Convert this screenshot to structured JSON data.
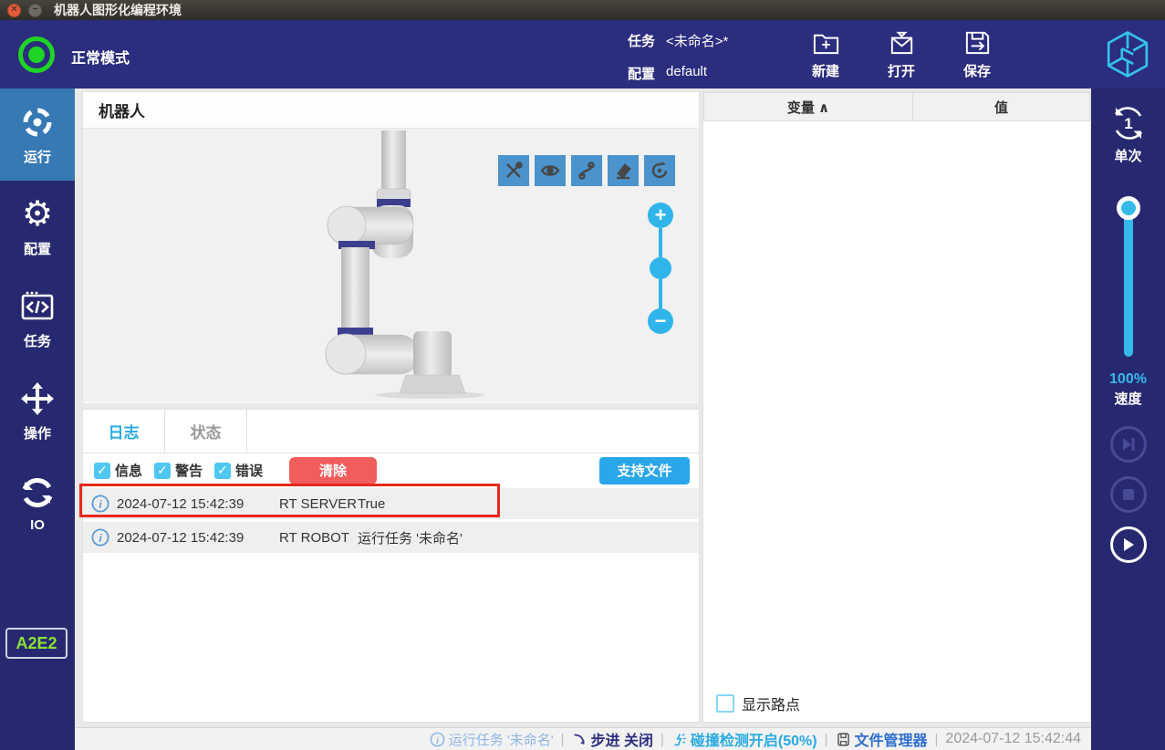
{
  "window": {
    "title": "机器人图形化编程环境"
  },
  "header": {
    "mode": "正常模式",
    "task_label": "任务",
    "task_value": "<未命名>*",
    "config_label": "配置",
    "config_value": "default",
    "actions": [
      {
        "icon": "new-folder-icon",
        "label": "新建"
      },
      {
        "icon": "open-icon",
        "label": "打开"
      },
      {
        "icon": "save-icon",
        "label": "保存"
      }
    ],
    "logo_icon": "cube-logo"
  },
  "sidebar": {
    "items": [
      {
        "icon": "run-target-icon",
        "label": "运行",
        "active": true
      },
      {
        "icon": "gear-icon",
        "label": "配置",
        "active": false
      },
      {
        "icon": "code-window-icon",
        "label": "任务",
        "active": false
      },
      {
        "icon": "move-arrows-icon",
        "label": "操作",
        "active": false
      },
      {
        "icon": "io-swap-icon",
        "label": "IO",
        "active": false
      }
    ],
    "badge": "A2E2"
  },
  "robot_panel": {
    "title": "机器人",
    "toolbar_icons": [
      "tools-icon",
      "eye-icon",
      "path-icon",
      "eraser-icon",
      "rotate-icon"
    ],
    "zoom_in": "+",
    "zoom_out": "−"
  },
  "log_panel": {
    "tabs": [
      {
        "label": "日志",
        "active": true
      },
      {
        "label": "状态",
        "active": false
      }
    ],
    "filters": [
      {
        "label": "信息",
        "checked": true
      },
      {
        "label": "警告",
        "checked": true
      },
      {
        "label": "错误",
        "checked": true
      }
    ],
    "check_glyph": "✓",
    "clear_button": "清除",
    "support_button": "支持文件",
    "entries": [
      {
        "icon": "info-icon",
        "time": "2024-07-12 15:42:39",
        "source": "RT SERVER",
        "message": "True",
        "highlighted": true
      },
      {
        "icon": "info-icon",
        "time": "2024-07-12 15:42:39",
        "source": "RT ROBOT",
        "message": "运行任务 '未命名'",
        "highlighted": false
      }
    ]
  },
  "variables_panel": {
    "col_variable": "变量 ∧",
    "col_value": "值",
    "show_waypoints_label": "显示路点",
    "show_waypoints_checked": false
  },
  "run_sidebar": {
    "loop_count": "1",
    "loop_label": "单次",
    "speed_value": "100%",
    "speed_label": "速度",
    "buttons": [
      {
        "icon": "step-forward-icon",
        "enabled": false
      },
      {
        "icon": "stop-icon",
        "enabled": false
      },
      {
        "icon": "play-icon",
        "enabled": true
      }
    ]
  },
  "status_bar": {
    "task_status": "运行任务 '未命名'",
    "step_status": "步进 关闭",
    "collision_status": "碰撞检测开启(50%)",
    "file_manager": "文件管理器",
    "timestamp": "2024-07-12 15:42:44",
    "separator": "|"
  },
  "colors": {
    "header_bg": "#2b2d7e",
    "sidebar_bg": "#272970",
    "sidebar_active": "#3779b5",
    "accent_cyan": "#29abe2",
    "toolbar_blue": "#4b93cc",
    "clear_red": "#f25c5c",
    "support_blue": "#2aa6ea",
    "annotation_red": "#e8281e",
    "mode_green": "#1fd425",
    "badge_green": "#8ae234",
    "logo_cyan": "#35c1ea"
  }
}
